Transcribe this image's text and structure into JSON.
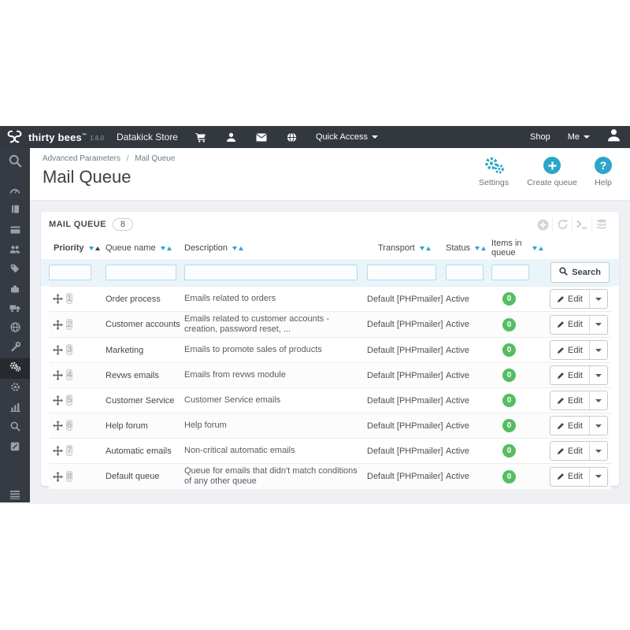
{
  "topbar": {
    "brand": "thirty bees",
    "trademark": "™",
    "version": "1.6.0",
    "store": "Datakick Store",
    "quick_access": "Quick Access",
    "shop": "Shop",
    "me": "Me",
    "icons": [
      "cart-icon",
      "user-icon",
      "envelope-icon",
      "globe-icon",
      "avatar-icon"
    ]
  },
  "sidebar": {
    "icons": [
      "search-icon",
      "dashboard-icon",
      "catalog-icon",
      "orders-icon",
      "customers-icon",
      "price-rules-icon",
      "modules-icon",
      "shipping-icon",
      "localization-icon",
      "tools-icon",
      "advanced-parameters-icon",
      "preferences-icon",
      "stats-icon",
      "search-small-icon",
      "logs-icon",
      "menu-collapse-icon"
    ],
    "active_item": "advanced-parameters"
  },
  "breadcrumb": {
    "parent": "Advanced Parameters",
    "separator": "/",
    "current": "Mail Queue"
  },
  "page": {
    "title": "Mail Queue"
  },
  "actions": [
    {
      "label": "Settings",
      "icon": "gears-icon"
    },
    {
      "label": "Create queue",
      "icon": "plus-circle-icon"
    },
    {
      "label": "Help",
      "icon": "question-circle-icon"
    }
  ],
  "panel": {
    "title": "MAIL QUEUE",
    "count": "8",
    "tools": [
      "add-icon",
      "refresh-icon",
      "console-icon",
      "database-icon"
    ]
  },
  "table": {
    "columns": [
      "Priority",
      "Queue name",
      "Description",
      "Transport",
      "Status",
      "Items in queue"
    ],
    "search_label": "Search",
    "edit_label": "Edit",
    "rows": [
      {
        "priority": "1",
        "name": "Order process",
        "description": "Emails related to orders",
        "transport": "Default [PHPmailer]",
        "status": "Active",
        "items": "0"
      },
      {
        "priority": "2",
        "name": "Customer accounts",
        "description": "Emails related to customer accounts - creation, password reset, ...",
        "transport": "Default [PHPmailer]",
        "status": "Active",
        "items": "0"
      },
      {
        "priority": "3",
        "name": "Marketing",
        "description": "Emails to promote sales of products",
        "transport": "Default [PHPmailer]",
        "status": "Active",
        "items": "0"
      },
      {
        "priority": "4",
        "name": "Revws emails",
        "description": "Emails from revws module",
        "transport": "Default [PHPmailer]",
        "status": "Active",
        "items": "0"
      },
      {
        "priority": "5",
        "name": "Customer Service",
        "description": "Customer Service emails",
        "transport": "Default [PHPmailer]",
        "status": "Active",
        "items": "0"
      },
      {
        "priority": "6",
        "name": "Help forum",
        "description": "Help forum",
        "transport": "Default [PHPmailer]",
        "status": "Active",
        "items": "0"
      },
      {
        "priority": "7",
        "name": "Automatic emails",
        "description": "Non-critical automatic emails",
        "transport": "Default [PHPmailer]",
        "status": "Active",
        "items": "0"
      },
      {
        "priority": "8",
        "name": "Default queue",
        "description": "Queue for emails that didn't match conditions of any other queue",
        "transport": "Default [PHPmailer]",
        "status": "Active",
        "items": "0"
      }
    ]
  },
  "colors": {
    "accent": "#2ba6c9",
    "badge_green": "#56bd61",
    "topbar_bg": "#33373e",
    "sidebar_bg": "#363a42"
  }
}
